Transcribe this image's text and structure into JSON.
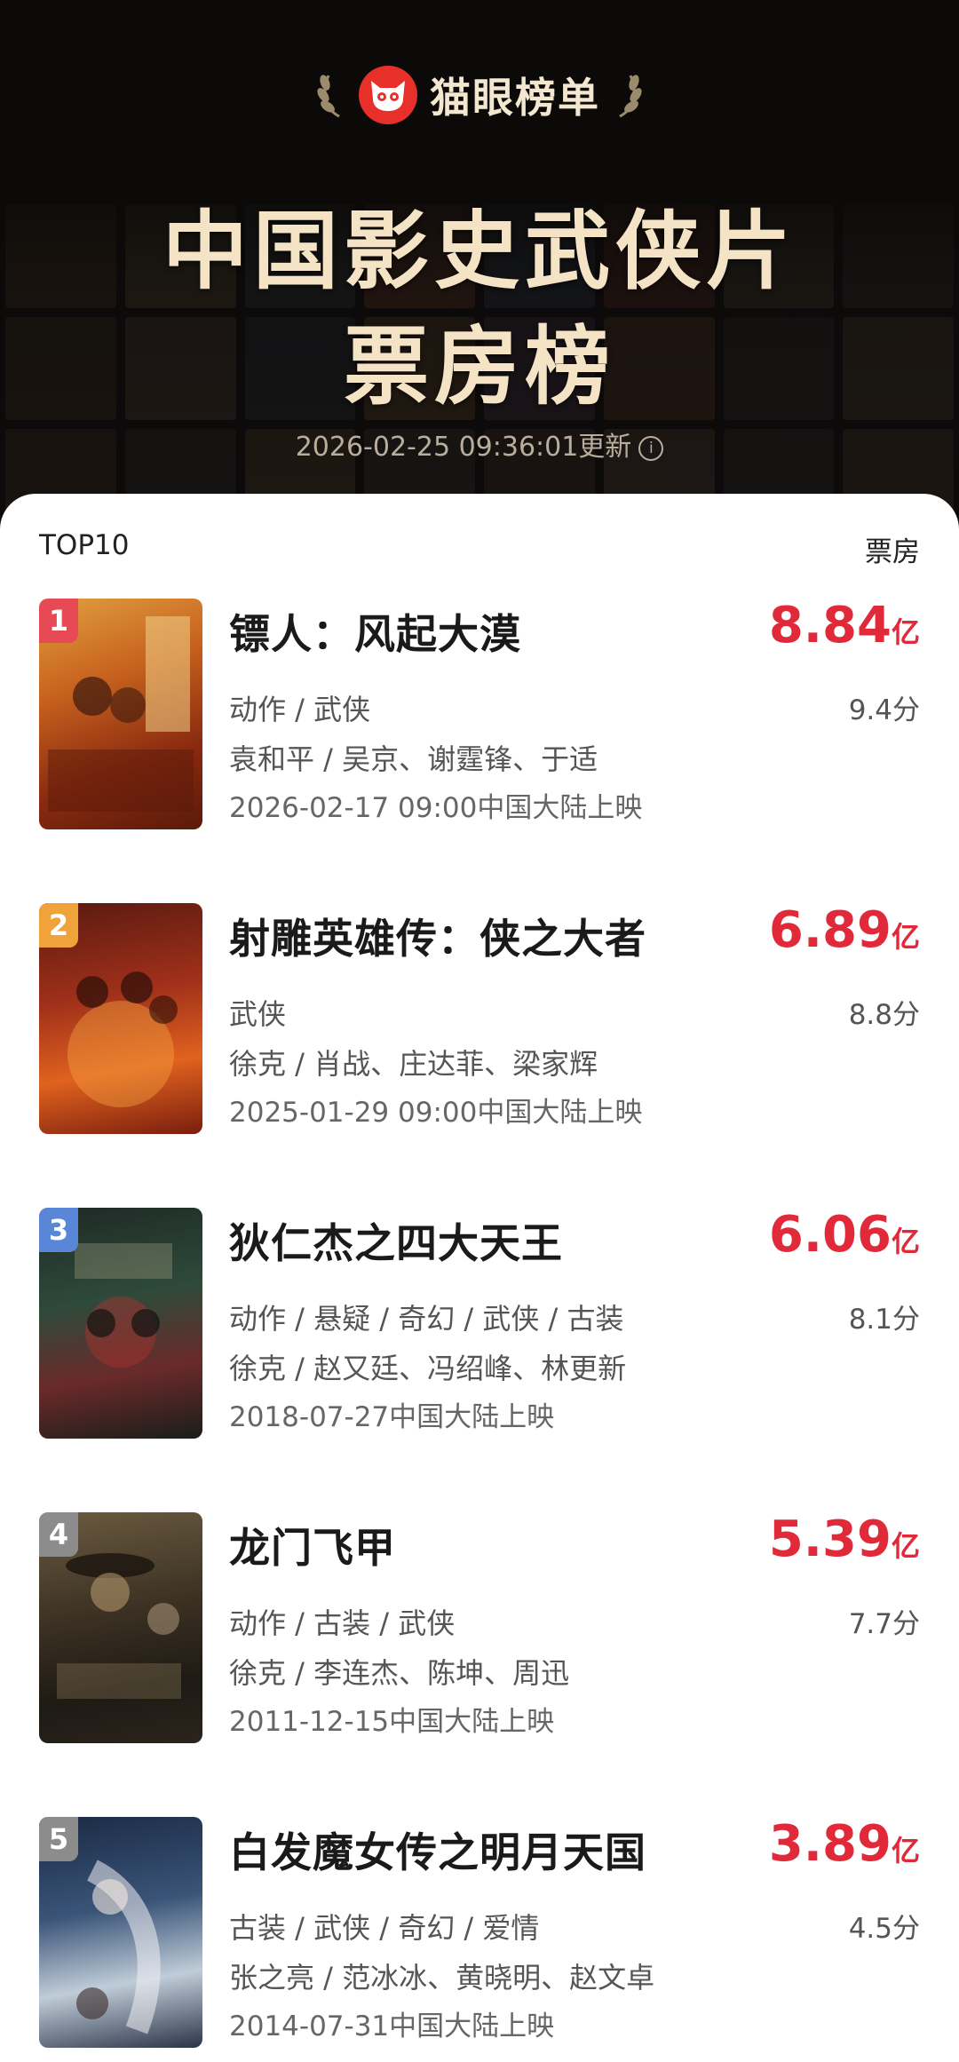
{
  "brand": {
    "name": "猫眼榜单"
  },
  "title": {
    "line1": "中国影史武侠片",
    "line2": "票房榜"
  },
  "updated": "2026-02-25 09:36:01更新",
  "list_header": {
    "left": "TOP10",
    "right": "票房"
  },
  "colors": {
    "accent": "#e02a3a",
    "logo": "#e8302a"
  },
  "movies": [
    {
      "rank": "1",
      "title": "镖人：风起大漠",
      "box_num": "8.84",
      "box_unit": "亿",
      "genre": "动作 / 武侠",
      "score": "9.4分",
      "cast": "袁和平 / 吴京、谢霆锋、于适",
      "release": "2026-02-17 09:00中国大陆上映",
      "rank_color": "#e84a55"
    },
    {
      "rank": "2",
      "title": "射雕英雄传：侠之大者",
      "box_num": "6.89",
      "box_unit": "亿",
      "genre": "武侠",
      "score": "8.8分",
      "cast": "徐克 / 肖战、庄达菲、梁家辉",
      "release": "2025-01-29 09:00中国大陆上映",
      "rank_color": "#f0a33a"
    },
    {
      "rank": "3",
      "title": "狄仁杰之四大天王",
      "box_num": "6.06",
      "box_unit": "亿",
      "genre": "动作 / 悬疑 / 奇幻 / 武侠 / 古装",
      "score": "8.1分",
      "cast": "徐克 / 赵又廷、冯绍峰、林更新",
      "release": "2018-07-27中国大陆上映",
      "rank_color": "#5a86d8"
    },
    {
      "rank": "4",
      "title": "龙门飞甲",
      "box_num": "5.39",
      "box_unit": "亿",
      "genre": "动作 / 古装 / 武侠",
      "score": "7.7分",
      "cast": "徐克 / 李连杰、陈坤、周迅",
      "release": "2011-12-15中国大陆上映",
      "rank_color": "#8c8c8c"
    },
    {
      "rank": "5",
      "title": "白发魔女传之明月天国",
      "box_num": "3.89",
      "box_unit": "亿",
      "genre": "古装 / 武侠 / 奇幻 / 爱情",
      "score": "4.5分",
      "cast": "张之亮 / 范冰冰、黄晓明、赵文卓",
      "release": "2014-07-31中国大陆上映",
      "rank_color": "#8c8c8c"
    }
  ]
}
